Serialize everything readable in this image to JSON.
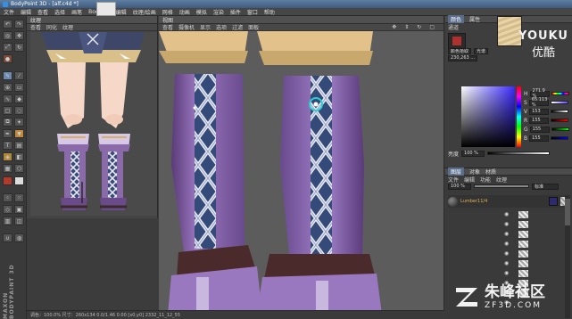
{
  "window": {
    "title": "BodyPoint 3D - [alf.c4d *]"
  },
  "menu": [
    "文件",
    "编辑",
    "查看",
    "选择",
    "画笔",
    "Body",
    "UV编辑",
    "纹理/绘画",
    "网格",
    "动画",
    "模拟",
    "渲染",
    "插件",
    "窗口",
    "帮助"
  ],
  "left_panel": {
    "title": "纹理",
    "menu": [
      "查看",
      "同化",
      "纹理"
    ]
  },
  "main_view": {
    "title": "视图",
    "menu": [
      "查看",
      "摄像机",
      "显示",
      "选项",
      "过滤",
      "面板"
    ]
  },
  "right_panel": {
    "tabs_top": [
      "颜色",
      "属性"
    ],
    "tool_label": "通道",
    "color_section_label": "颜色",
    "color_mode_options": [
      "颜色拾取",
      "光谱",
      "RGB"
    ],
    "selected_color_mode": "RGB",
    "color_readout": "230,263 ...",
    "channels": [
      {
        "label": "H",
        "value": "271.9 %"
      },
      {
        "label": "S",
        "value": "65.113 %"
      },
      {
        "label": "V",
        "value": "153"
      },
      {
        "label": "R",
        "value": "155"
      },
      {
        "label": "G",
        "value": "155"
      },
      {
        "label": "B",
        "value": "155"
      }
    ],
    "brightness_label": "亮度",
    "brightness_value": "100 %",
    "layers_tabs": [
      "图层",
      "对象",
      "材质"
    ],
    "layers_menu": [
      "文件",
      "编辑",
      "功能",
      "纹理"
    ],
    "opacity_value": "100 %",
    "blend_mode": "标准",
    "layer_name": "Lumber11/4",
    "swatch_color": "#2e2a6e"
  },
  "status": {
    "text": "调色：100.0%  尺寸：260x134  0.0/1.46  0.00 [x0,y0] 2332_11_12_55"
  },
  "watermark": {
    "youku_en": "YOUKU",
    "youku_cn": "优酷",
    "site_cn": "朱峰社区",
    "site_en": "ZF3D.COM"
  }
}
